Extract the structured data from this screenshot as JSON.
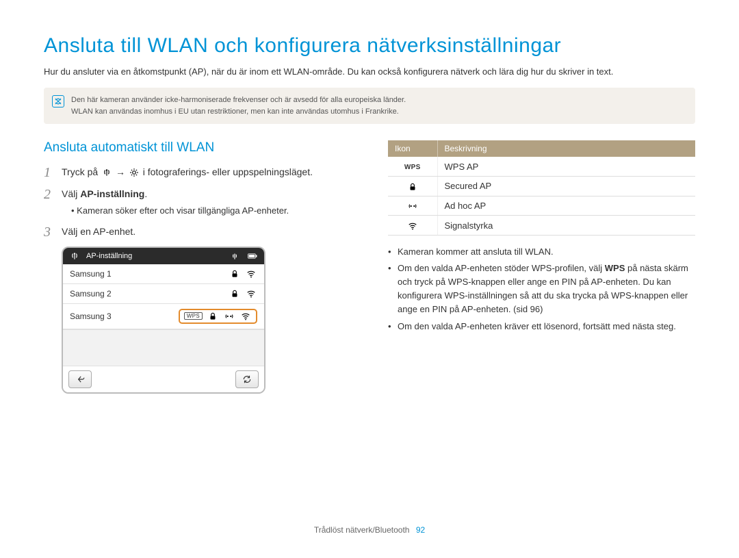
{
  "heading": "Ansluta till WLAN och konfigurera nätverksinställningar",
  "intro": "Hur du ansluter via en åtkomstpunkt (AP), när du är inom ett WLAN-område. Du kan också konfigurera nätverk och lära dig hur du skriver in text.",
  "info_line1": "Den här kameran använder icke-harmoniserade frekvenser och är avsedd för alla europeiska länder.",
  "info_line2": "WLAN kan användas inomhus i EU utan restriktioner, men kan inte användas utomhus i Frankrike.",
  "section_title": "Ansluta automatiskt till WLAN",
  "step1_a": "Tryck på ",
  "step1_b": " i fotograferings- eller uppspelningsläget.",
  "arrow": "→",
  "step2_a": "Välj ",
  "step2_b": "AP-inställning",
  "step2_c": ".",
  "step2_sub": "Kameran söker efter och visar tillgängliga AP-enheter.",
  "step3": "Välj en AP-enhet.",
  "ap_panel": {
    "title": "AP-inställning",
    "rows": [
      {
        "name": "Samsung 1",
        "wps": false,
        "lock": true,
        "adhoc": false,
        "selected": false
      },
      {
        "name": "Samsung 2",
        "wps": false,
        "lock": true,
        "adhoc": false,
        "selected": false
      },
      {
        "name": "Samsung 3",
        "wps": true,
        "lock": true,
        "adhoc": true,
        "selected": true
      }
    ],
    "wps_label": "WPS"
  },
  "icon_table": {
    "th1": "Ikon",
    "th2": "Beskrivning",
    "rows": [
      {
        "label": "WPS",
        "desc": "WPS AP"
      },
      {
        "label": "lock",
        "desc": "Secured AP"
      },
      {
        "label": "adhoc",
        "desc": "Ad hoc AP"
      },
      {
        "label": "signal",
        "desc": "Signalstyrka"
      }
    ],
    "wps_badge": "WPS"
  },
  "right_bullets": {
    "b1": "Kameran kommer att ansluta till WLAN.",
    "b2a": "Om den valda AP-enheten stöder WPS-profilen, välj ",
    "b2bold": "WPS",
    "b2b": " på nästa skärm och tryck på WPS-knappen eller ange en PIN på AP-enheten. Du kan konfigurera WPS-inställningen så att du ska trycka på WPS-knappen eller ange en PIN på AP-enheten. (sid 96)",
    "b3": "Om den valda AP-enheten kräver ett lösenord, fortsätt med nästa steg."
  },
  "footer": {
    "text": "Trådlöst nätverk/Bluetooth",
    "page": "92"
  }
}
